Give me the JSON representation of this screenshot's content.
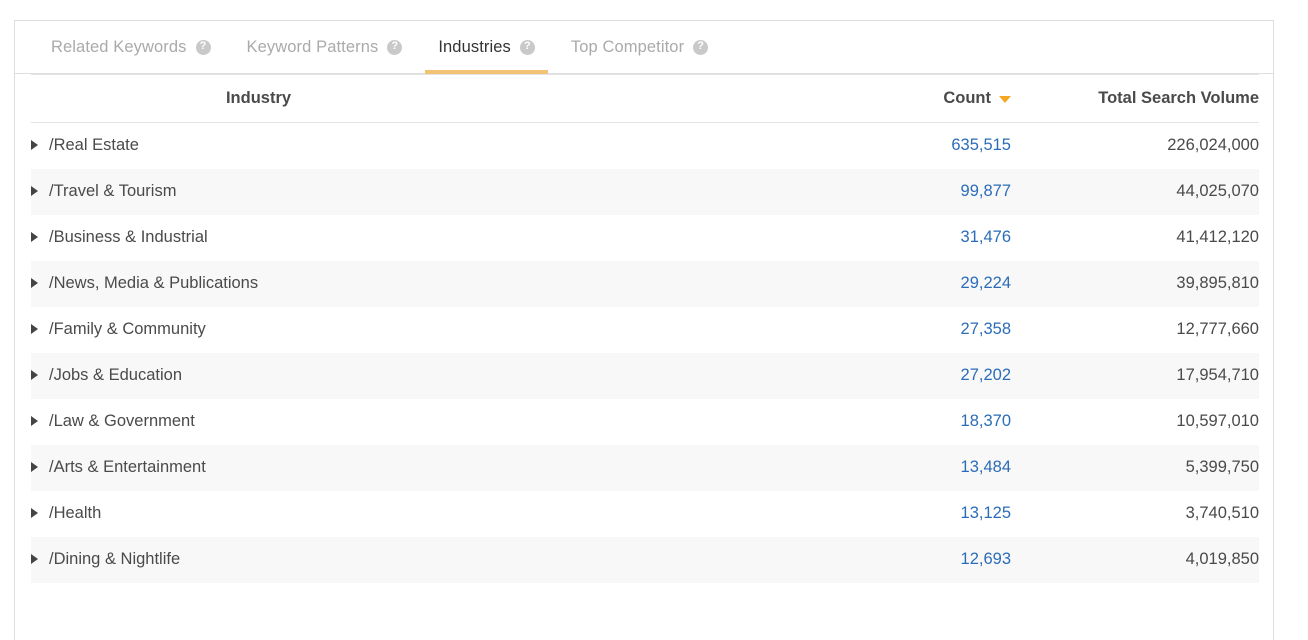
{
  "tabs": [
    {
      "label": "Related Keywords",
      "active": false,
      "help_icon": "help-circle-icon",
      "help_glyph": "?"
    },
    {
      "label": "Keyword Patterns",
      "active": false,
      "help_icon": "help-circle-icon",
      "help_glyph": "?"
    },
    {
      "label": "Industries",
      "active": true,
      "help_icon": "help-circle-icon",
      "help_glyph": "?"
    },
    {
      "label": "Top Competitor",
      "active": false,
      "help_icon": "help-circle-icon",
      "help_glyph": "?"
    }
  ],
  "table": {
    "columns": {
      "industry": "Industry",
      "count": "Count",
      "volume": "Total Search Volume"
    },
    "sort": {
      "column": "Count",
      "direction": "desc",
      "caret_icon": "sort-desc-caret-icon"
    },
    "expander_icon": "expand-triangle-icon",
    "rows": [
      {
        "industry": "/Real Estate",
        "count": "635,515",
        "volume": "226,024,000"
      },
      {
        "industry": "/Travel & Tourism",
        "count": "99,877",
        "volume": "44,025,070"
      },
      {
        "industry": "/Business & Industrial",
        "count": "31,476",
        "volume": "41,412,120"
      },
      {
        "industry": "/News, Media & Publications",
        "count": "29,224",
        "volume": "39,895,810"
      },
      {
        "industry": "/Family & Community",
        "count": "27,358",
        "volume": "12,777,660"
      },
      {
        "industry": "/Jobs & Education",
        "count": "27,202",
        "volume": "17,954,710"
      },
      {
        "industry": "/Law & Government",
        "count": "18,370",
        "volume": "10,597,010"
      },
      {
        "industry": "/Arts & Entertainment",
        "count": "13,484",
        "volume": "5,399,750"
      },
      {
        "industry": "/Health",
        "count": "13,125",
        "volume": "3,740,510"
      },
      {
        "industry": "/Dining & Nightlife",
        "count": "12,693",
        "volume": "4,019,850"
      }
    ]
  },
  "colors": {
    "accent_orange": "#f2c375",
    "sort_caret_orange": "#f5a623",
    "link_blue": "#2b6cb8",
    "text_dark": "#4a4a4a",
    "text_muted": "#aaaaaa",
    "border": "#dedede",
    "stripe": "#f8f8f8"
  }
}
